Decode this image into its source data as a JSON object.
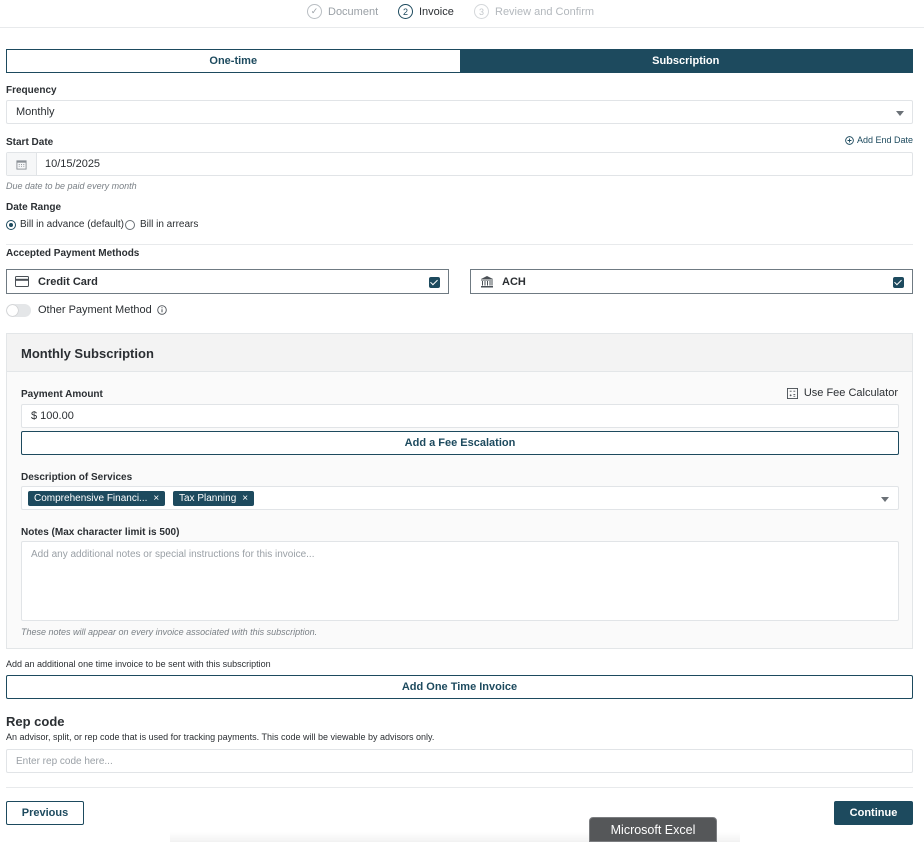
{
  "stepper": {
    "steps": [
      {
        "num": "✓",
        "label": "Document"
      },
      {
        "num": "2",
        "label": "Invoice"
      },
      {
        "num": "3",
        "label": "Review and Confirm"
      }
    ]
  },
  "billing_type": {
    "one_time": "One-time",
    "subscription": "Subscription",
    "selected": "Subscription"
  },
  "frequency": {
    "label": "Frequency",
    "value": "Monthly"
  },
  "start_date": {
    "label": "Start Date",
    "value": "10/15/2025",
    "add_end_date": "Add End Date",
    "hint": "Due date to be paid every month"
  },
  "date_range": {
    "label": "Date Range",
    "options": [
      "Bill in advance (default)",
      "Bill in arrears"
    ],
    "selected": "Bill in advance (default)"
  },
  "payment_methods": {
    "label": "Accepted Payment Methods",
    "methods": [
      {
        "name": "Credit Card",
        "checked": true,
        "icon": "credit-card-icon"
      },
      {
        "name": "ACH",
        "checked": true,
        "icon": "bank-icon"
      }
    ],
    "other_label": "Other Payment Method"
  },
  "subscription": {
    "title": "Monthly Subscription",
    "payment_amount_label": "Payment Amount",
    "fee_calculator": "Use Fee Calculator",
    "payment_amount": "$ 100.00",
    "fee_escalation": "Add a Fee Escalation",
    "services_label": "Description of Services",
    "services": [
      "Comprehensive Financi...",
      "Tax Planning"
    ],
    "notes_label": "Notes (Max character limit is 500)",
    "notes_placeholder": "Add any additional notes or special instructions for this invoice...",
    "notes_hint": "These notes will appear on every invoice associated with this subscription."
  },
  "one_time": {
    "text": "Add an additional one time invoice to be sent with this subscription",
    "button": "Add One Time Invoice"
  },
  "rep_code": {
    "title": "Rep code",
    "description": "An advisor, split, or rep code that is used for tracking payments. This code will be viewable by advisors only.",
    "placeholder": "Enter rep code here..."
  },
  "nav": {
    "previous": "Previous",
    "continue": "Continue"
  },
  "taskbar": {
    "app": "Microsoft Excel"
  },
  "colors": {
    "primary": "#1d4a5e",
    "border": "#e1e4e7"
  }
}
